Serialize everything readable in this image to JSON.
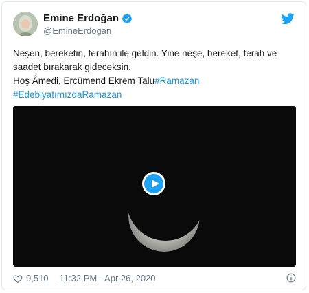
{
  "author": {
    "name": "Emine Erdoğan",
    "handle": "@EmineErdogan"
  },
  "tweet": {
    "line1": "Neşen, bereketin, ferahın ile geldin. Yine neşe, bereket, ferah ve",
    "line2": "saadet bırakarak gideceksin.",
    "line3_text": "Hoş Âmedi, Ercümend Ekrem Talu",
    "hashtag1": "#Ramazan",
    "hashtag2": "#EdebiyatımızdaRamazan"
  },
  "footer": {
    "likes": "9,510",
    "timestamp": "11:32 PM - Apr 26, 2020"
  },
  "colors": {
    "accent": "#1da1f2",
    "hashtag": "#1b95e0",
    "muted": "#657786"
  },
  "icons": {
    "verified": "verified-badge-icon",
    "brand": "twitter-bird-icon",
    "play": "play-icon",
    "like": "heart-icon",
    "info": "info-icon"
  }
}
